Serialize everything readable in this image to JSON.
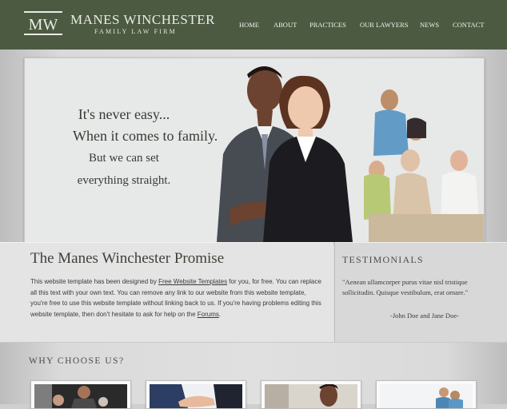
{
  "header": {
    "logo_monogram": "MW",
    "brand_name": "MANES WINCHESTER",
    "tagline": "FAMILY LAW FIRM"
  },
  "nav": [
    {
      "label": "HOME"
    },
    {
      "label": "ABOUT"
    },
    {
      "label": "PRACTICES"
    },
    {
      "label": "OUR LAWYERS"
    },
    {
      "label": "NEWS"
    },
    {
      "label": "CONTACT"
    }
  ],
  "hero": {
    "line1": "It's never easy...",
    "line2": "When it comes to family.",
    "line3": "But we can set",
    "line4": "everything straight."
  },
  "promise": {
    "title": "The Manes Winchester Promise",
    "p1": "This website template has been designed by ",
    "link1": "Free Website Templates",
    "p2": " for you, for free. You can replace all this text with your own text. You can remove any link to our website from this website template, you're free to use this website template without linking back to us. If you're having problems editing this website template, then don't hesitate to ask for help on the ",
    "link2": "Forums",
    "p3": "."
  },
  "testimonials": {
    "title": "TESTIMONIALS",
    "quote": "\"Aenean ullamcorper purus vitae nisl tristique sollicitudin. Quisque vestibulum, erat ornare.\"",
    "author": "-John Doe and Jane Doe-"
  },
  "why": {
    "title": "WHY CHOOSE US?"
  },
  "colors": {
    "header_bg": "#4c5a42",
    "page_bg": "#dcdcdc",
    "hero_bg": "#e7e8e8"
  }
}
